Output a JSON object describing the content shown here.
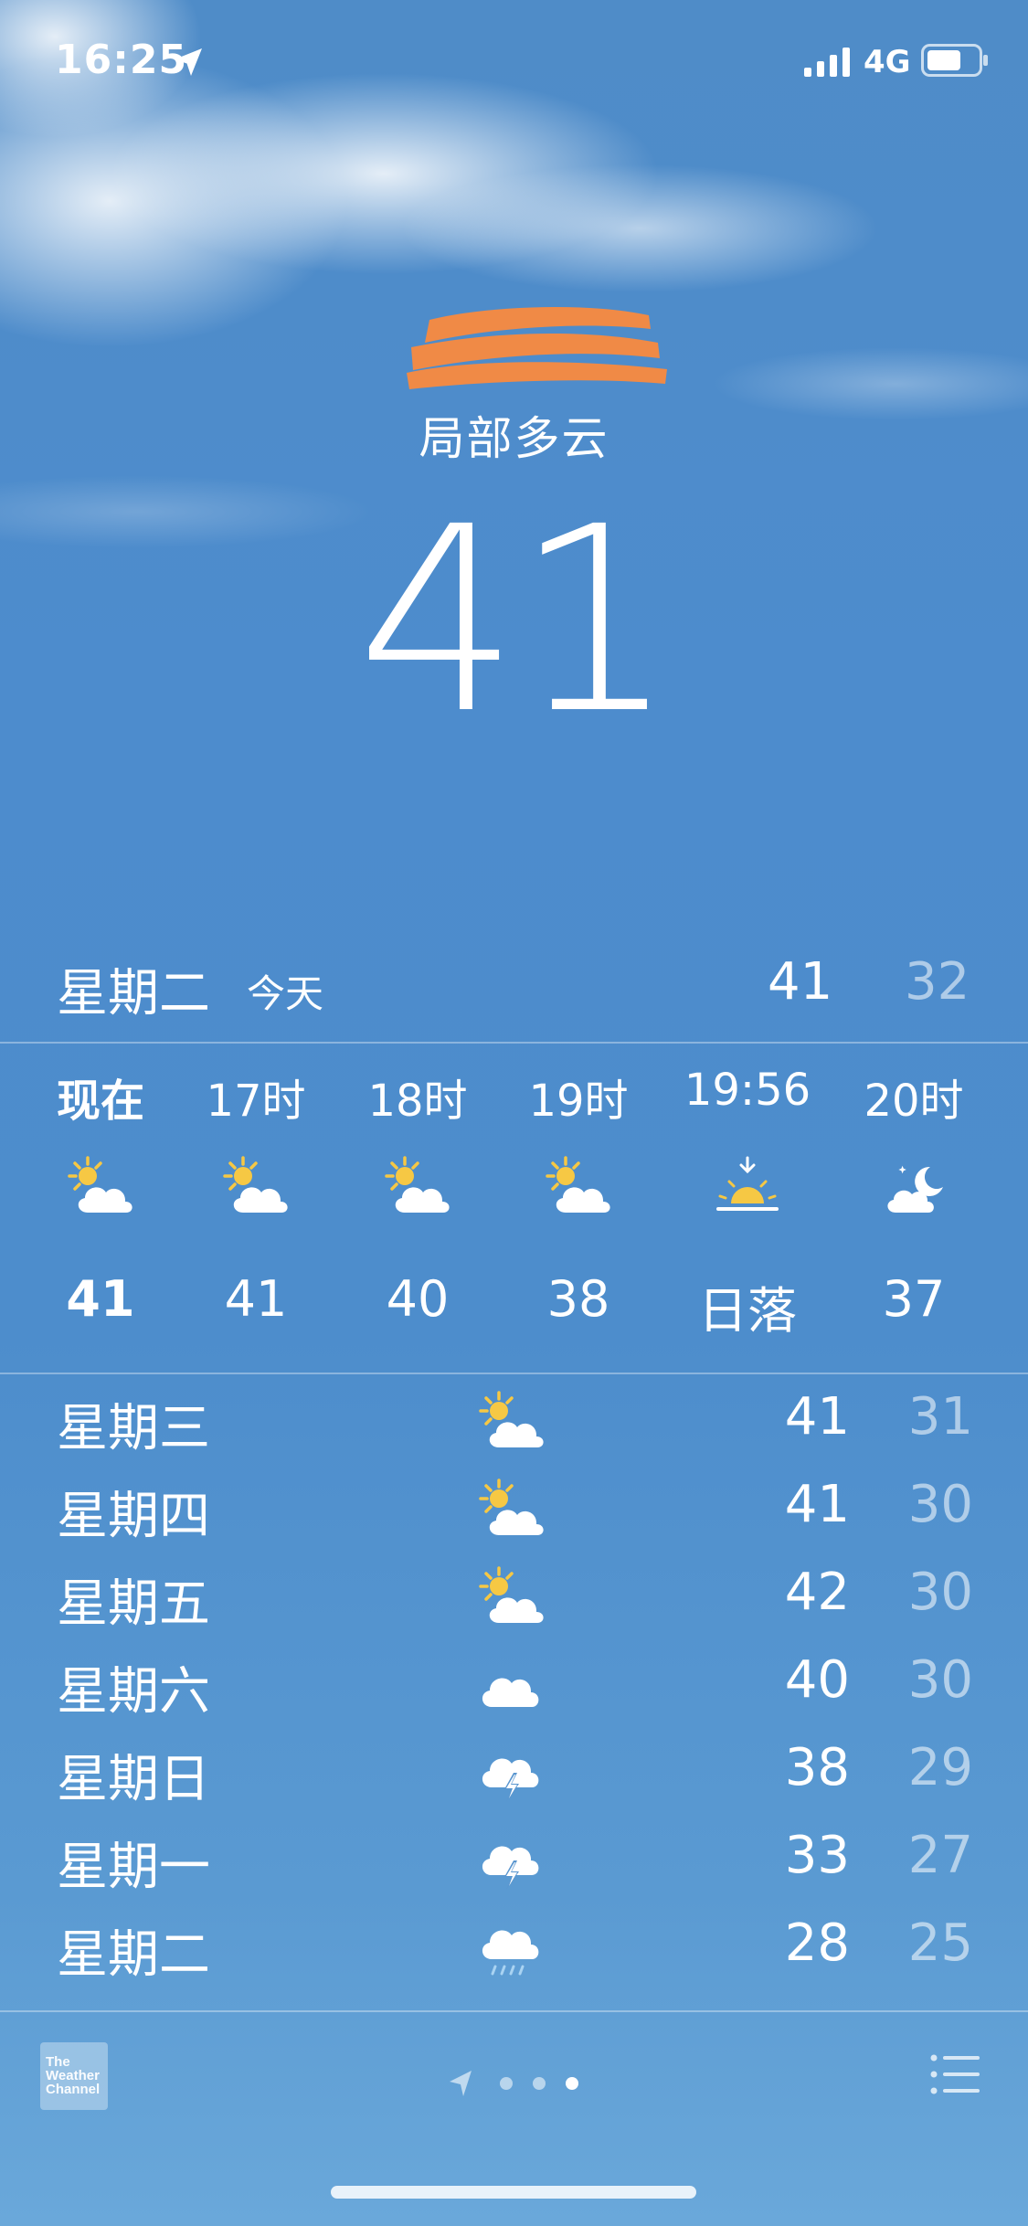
{
  "status_bar": {
    "time": "16:25",
    "network": "4G",
    "icons": [
      "location-arrow-icon",
      "signal-bars-icon",
      "battery-icon"
    ]
  },
  "current": {
    "location_redacted": true,
    "condition": "局部多云",
    "temperature": "41"
  },
  "today": {
    "day": "星期二",
    "label": "今天",
    "high": "41",
    "low": "32"
  },
  "hourly": [
    {
      "time": "现在",
      "icon": "partly-sunny-icon",
      "temp": "41",
      "is_now": true
    },
    {
      "time": "17时",
      "icon": "partly-sunny-icon",
      "temp": "41"
    },
    {
      "time": "18时",
      "icon": "partly-sunny-icon",
      "temp": "40"
    },
    {
      "time": "19时",
      "icon": "partly-sunny-icon",
      "temp": "38"
    },
    {
      "time": "19:56",
      "icon": "sunset-icon",
      "temp": "日落"
    },
    {
      "time": "20时",
      "icon": "partly-cloudy-night-icon",
      "temp": "37"
    }
  ],
  "daily": [
    {
      "day": "星期三",
      "icon": "partly-sunny-icon",
      "high": "41",
      "low": "31"
    },
    {
      "day": "星期四",
      "icon": "partly-sunny-icon",
      "high": "41",
      "low": "30"
    },
    {
      "day": "星期五",
      "icon": "partly-sunny-icon",
      "high": "42",
      "low": "30"
    },
    {
      "day": "星期六",
      "icon": "cloud-icon",
      "high": "40",
      "low": "30"
    },
    {
      "day": "星期日",
      "icon": "thunderstorm-icon",
      "high": "38",
      "low": "29"
    },
    {
      "day": "星期一",
      "icon": "thunderstorm-icon",
      "high": "33",
      "low": "27"
    },
    {
      "day": "星期二",
      "icon": "rain-icon",
      "high": "28",
      "low": "25"
    }
  ],
  "footer": {
    "logo_text": [
      "The",
      "Weather",
      "Channel"
    ],
    "page_count": 3,
    "active_page": 3
  },
  "colors": {
    "sun": "#f6c844",
    "background_top": "#4f8cc8",
    "background_bottom": "#6aa8da",
    "redaction": "#f08a46"
  }
}
